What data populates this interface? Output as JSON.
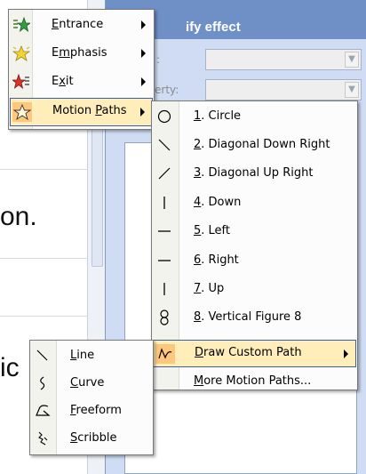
{
  "background": {
    "slide_text_1": "on.",
    "slide_text_2": "ic",
    "task_pane_title": "ify effect",
    "label_1": ":",
    "label_2": "erty:"
  },
  "menu_main": {
    "items": [
      {
        "pre": "",
        "u": "E",
        "post": "ntrance",
        "icon": "entrance-star-icon"
      },
      {
        "pre": "E",
        "u": "m",
        "post": "phasis",
        "icon": "emphasis-star-icon"
      },
      {
        "pre": "E",
        "u": "x",
        "post": "it",
        "icon": "exit-star-icon"
      },
      {
        "pre": "Motion ",
        "u": "P",
        "post": "aths",
        "icon": "motion-paths-star-icon"
      }
    ]
  },
  "menu_motion_paths": {
    "items": [
      {
        "u": "1",
        "post": ". Circle",
        "icon": "circle-path-icon"
      },
      {
        "u": "2",
        "post": ". Diagonal Down Right",
        "icon": "diagonal-down-right-icon"
      },
      {
        "u": "3",
        "post": ". Diagonal Up Right",
        "icon": "diagonal-up-right-icon"
      },
      {
        "u": "4",
        "post": ". Down",
        "icon": "down-path-icon"
      },
      {
        "u": "5",
        "post": ". Left",
        "icon": "left-path-icon"
      },
      {
        "u": "6",
        "post": ". Right",
        "icon": "right-path-icon"
      },
      {
        "u": "7",
        "post": ". Up",
        "icon": "up-path-icon"
      },
      {
        "u": "8",
        "post": ". Vertical Figure 8",
        "icon": "figure-8-icon"
      },
      {
        "u": "D",
        "post": "raw Custom Path",
        "icon": "draw-custom-path-icon"
      },
      {
        "u": "M",
        "post": "ore Motion Paths...",
        "icon": ""
      }
    ]
  },
  "menu_custom_path": {
    "items": [
      {
        "u": "L",
        "post": "ine",
        "icon": "line-tool-icon"
      },
      {
        "u": "C",
        "post": "urve",
        "icon": "curve-tool-icon"
      },
      {
        "u": "F",
        "post": "reeform",
        "icon": "freeform-tool-icon"
      },
      {
        "u": "S",
        "post": "cribble",
        "icon": "scribble-tool-icon"
      }
    ]
  },
  "colors": {
    "menu_highlight": "#ffeeb9",
    "menu_highlight_border": "#3f5f9f",
    "task_pane": "#cfdcf3",
    "task_pane_title": "#6f8fc7"
  }
}
